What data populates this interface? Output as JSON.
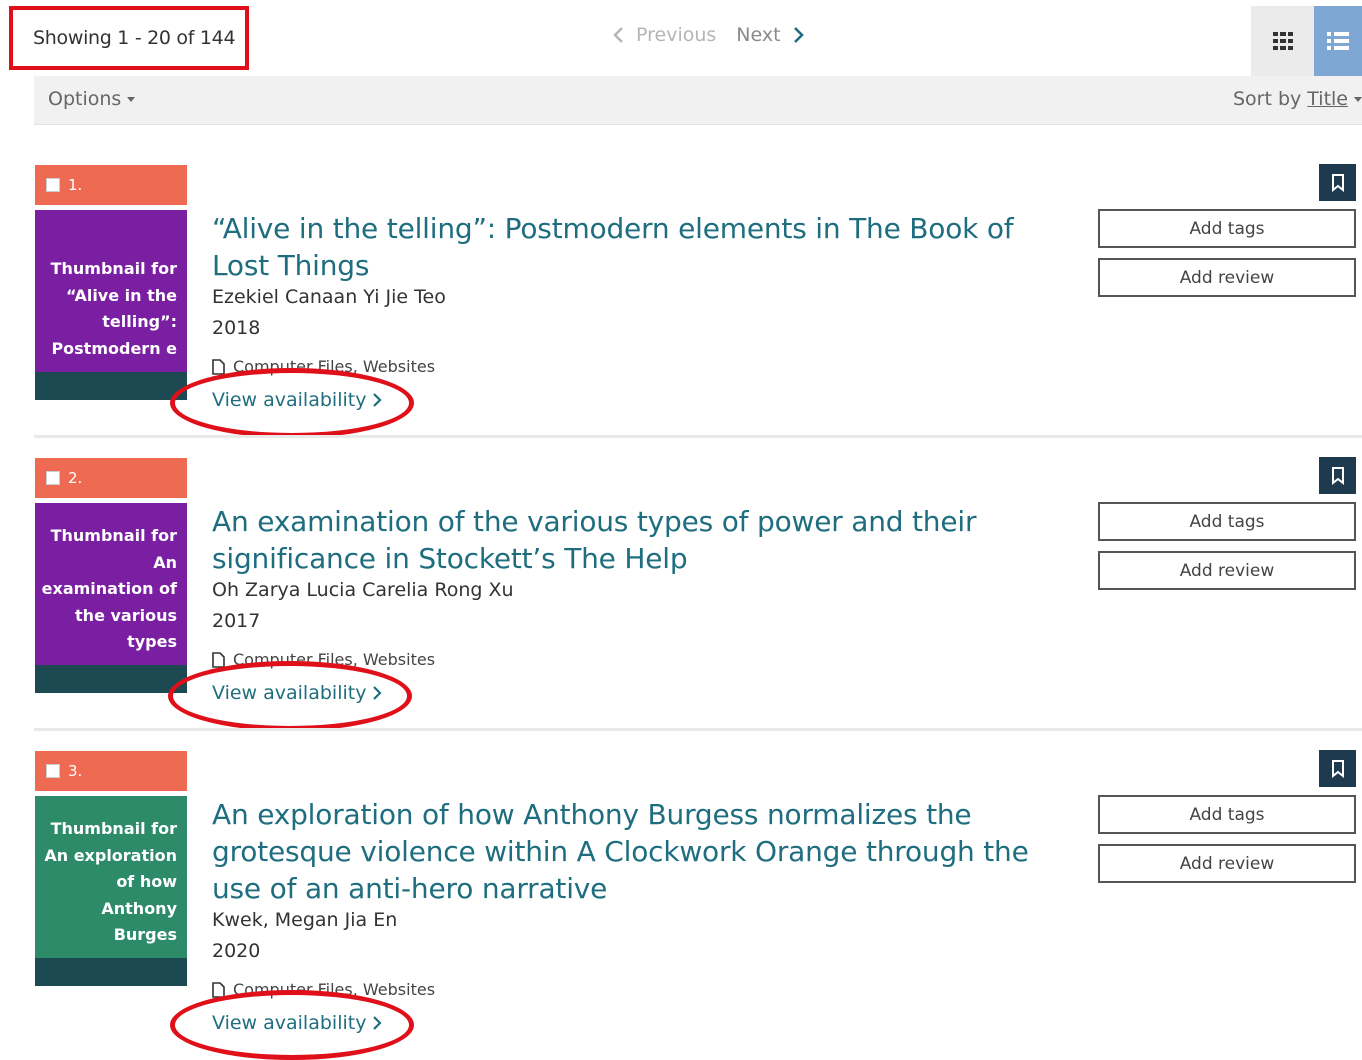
{
  "toolbar": {
    "showing": "Showing 1 - 20 of 144",
    "previous": "Previous",
    "next": "Next"
  },
  "options_bar": {
    "options_label": "Options",
    "sort_prefix": "Sort by",
    "sort_value": "Title"
  },
  "records": [
    {
      "number": "1.",
      "thumb_text": "Thumbnail for “Alive in the telling”: Postmodern e",
      "thumb_color": "#7b1fa2",
      "title": "“Alive in the telling”: Postmodern elements in The Book of Lost Things",
      "author": "Ezekiel Canaan Yi Jie Teo",
      "year": "2018",
      "format": "Computer Files, Websites",
      "availability": "View availability",
      "add_tags": "Add tags",
      "add_review": "Add review"
    },
    {
      "number": "2.",
      "thumb_text": "Thumbnail for An examination of the various types",
      "thumb_color": "#7b1fa2",
      "title": "An examination of the various types of power and their significance in Stockett’s The Help",
      "author": "Oh Zarya Lucia Carelia Rong Xu",
      "year": "2017",
      "format": "Computer Files, Websites",
      "availability": "View availability",
      "add_tags": "Add tags",
      "add_review": "Add review"
    },
    {
      "number": "3.",
      "thumb_text": "Thumbnail for An exploration of how Anthony Burges",
      "thumb_color": "#2e8b6a",
      "title": "An exploration of how Anthony Burgess normalizes the grotesque violence within A Clockwork Orange through the use of an anti-hero narrative",
      "author": "Kwek, Megan Jia En",
      "year": "2020",
      "format": "Computer Files, Websites",
      "availability": "View availability",
      "add_tags": "Add tags",
      "add_review": "Add review"
    }
  ],
  "icons": {
    "grid": "grid-view-icon",
    "list": "list-view-icon",
    "bookmark": "bookmark-icon",
    "file": "file-icon",
    "chevron": "chevron-right-icon"
  },
  "colors": {
    "accent_link": "#1f6e80",
    "number_tab": "#ef6a52",
    "annotation": "#e0101b",
    "list_view_active": "#7fa7d4"
  }
}
